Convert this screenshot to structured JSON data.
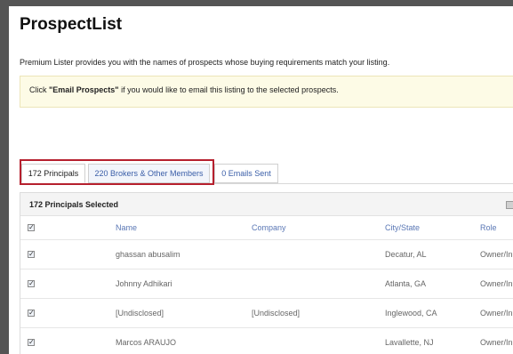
{
  "page": {
    "title": "ProspectList",
    "intro": "Premium Lister provides you with the names of prospects whose buying requirements match your listing."
  },
  "callout": {
    "prefix": "Click ",
    "action": "\"Email Prospects\"",
    "suffix": " if you would like to email this listing to the selected prospects."
  },
  "tabs": [
    {
      "label": "172 Principals",
      "active": true
    },
    {
      "label": "220 Brokers & Other Members",
      "active": false
    },
    {
      "label": "0 Emails Sent",
      "active": false
    }
  ],
  "table": {
    "selected_label": "172 Principals Selected",
    "headers": {
      "name": "Name",
      "company": "Company",
      "city": "City/State",
      "role": "Role"
    },
    "rows": [
      {
        "checked": true,
        "name": "ghassan abusalim",
        "company": "",
        "city": "Decatur, AL",
        "role": "Owner/In"
      },
      {
        "checked": true,
        "name": "Johnny Adhikari",
        "company": "",
        "city": "Atlanta, GA",
        "role": "Owner/In"
      },
      {
        "checked": true,
        "name": "[Undisclosed]",
        "company": "[Undisclosed]",
        "city": "Inglewood, CA",
        "role": "Owner/In"
      },
      {
        "checked": true,
        "name": "Marcos ARAUJO",
        "company": "",
        "city": "Lavallette, NJ",
        "role": "Owner/In"
      }
    ]
  },
  "colors": {
    "link": "#3a5ea8",
    "highlight": "#b6202e",
    "callout_bg": "#fdfbe6"
  }
}
